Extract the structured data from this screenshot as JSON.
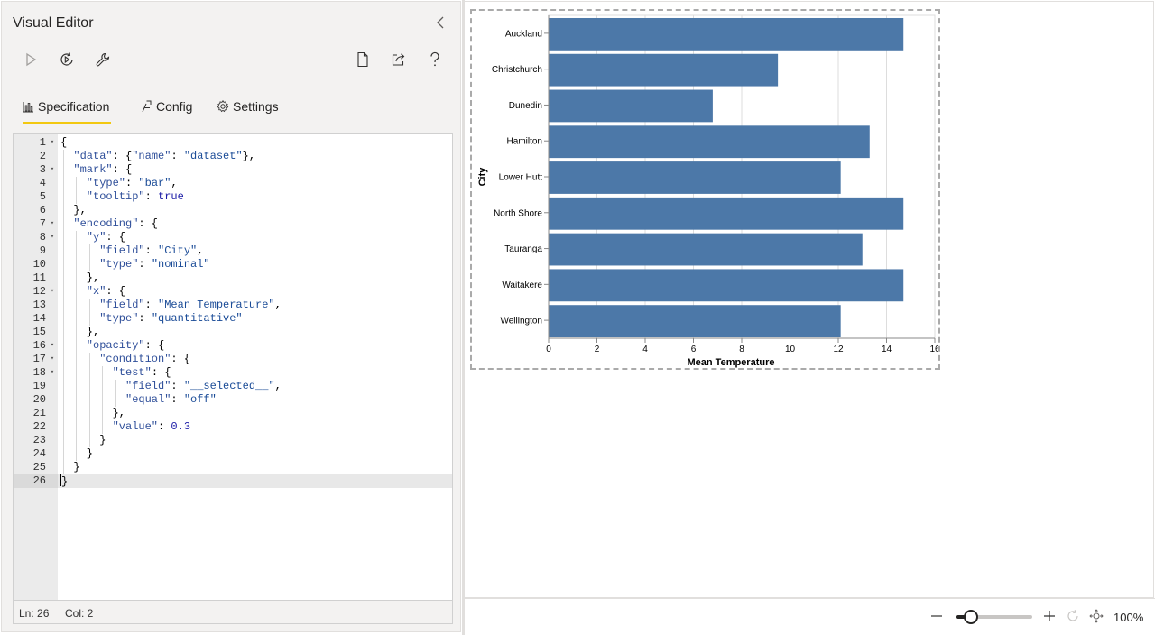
{
  "editor": {
    "title": "Visual Editor",
    "tabs": [
      {
        "label": "Specification",
        "icon": "bar-chart-icon"
      },
      {
        "label": "Config",
        "icon": "config-icon"
      },
      {
        "label": "Settings",
        "icon": "gear-icon"
      }
    ],
    "toolbar_icons": [
      "play-icon",
      "auto-apply-icon",
      "wrench-icon",
      "new-file-icon",
      "share-icon",
      "help-icon"
    ],
    "status": {
      "line": "Ln: 26",
      "col": "Col: 2"
    },
    "current_line": 26,
    "code_lines": [
      {
        "n": "1",
        "fold": true,
        "indent": 0,
        "tokens": [
          [
            "p",
            "{"
          ]
        ]
      },
      {
        "n": "2",
        "fold": false,
        "indent": 1,
        "tokens": [
          [
            "key",
            "\"data\""
          ],
          [
            "p",
            ": {"
          ],
          [
            "key",
            "\"name\""
          ],
          [
            "p",
            ": "
          ],
          [
            "str",
            "\"dataset\""
          ],
          [
            "p",
            "},"
          ]
        ]
      },
      {
        "n": "3",
        "fold": true,
        "indent": 1,
        "tokens": [
          [
            "key",
            "\"mark\""
          ],
          [
            "p",
            ": {"
          ]
        ]
      },
      {
        "n": "4",
        "fold": false,
        "indent": 2,
        "tokens": [
          [
            "key",
            "\"type\""
          ],
          [
            "p",
            ": "
          ],
          [
            "str",
            "\"bar\""
          ],
          [
            "p",
            ","
          ]
        ]
      },
      {
        "n": "5",
        "fold": false,
        "indent": 2,
        "tokens": [
          [
            "key",
            "\"tooltip\""
          ],
          [
            "p",
            ": "
          ],
          [
            "bool",
            "true"
          ]
        ]
      },
      {
        "n": "6",
        "fold": false,
        "indent": 1,
        "tokens": [
          [
            "p",
            "},"
          ]
        ]
      },
      {
        "n": "7",
        "fold": true,
        "indent": 1,
        "tokens": [
          [
            "key",
            "\"encoding\""
          ],
          [
            "p",
            ": {"
          ]
        ]
      },
      {
        "n": "8",
        "fold": true,
        "indent": 2,
        "tokens": [
          [
            "key",
            "\"y\""
          ],
          [
            "p",
            ": {"
          ]
        ]
      },
      {
        "n": "9",
        "fold": false,
        "indent": 3,
        "tokens": [
          [
            "key",
            "\"field\""
          ],
          [
            "p",
            ": "
          ],
          [
            "str",
            "\"City\""
          ],
          [
            "p",
            ","
          ]
        ]
      },
      {
        "n": "10",
        "fold": false,
        "indent": 3,
        "tokens": [
          [
            "key",
            "\"type\""
          ],
          [
            "p",
            ": "
          ],
          [
            "str",
            "\"nominal\""
          ]
        ]
      },
      {
        "n": "11",
        "fold": false,
        "indent": 2,
        "tokens": [
          [
            "p",
            "},"
          ]
        ]
      },
      {
        "n": "12",
        "fold": true,
        "indent": 2,
        "tokens": [
          [
            "key",
            "\"x\""
          ],
          [
            "p",
            ": {"
          ]
        ]
      },
      {
        "n": "13",
        "fold": false,
        "indent": 3,
        "tokens": [
          [
            "key",
            "\"field\""
          ],
          [
            "p",
            ": "
          ],
          [
            "str",
            "\"Mean Temperature\""
          ],
          [
            "p",
            ","
          ]
        ]
      },
      {
        "n": "14",
        "fold": false,
        "indent": 3,
        "tokens": [
          [
            "key",
            "\"type\""
          ],
          [
            "p",
            ": "
          ],
          [
            "str",
            "\"quantitative\""
          ]
        ]
      },
      {
        "n": "15",
        "fold": false,
        "indent": 2,
        "tokens": [
          [
            "p",
            "},"
          ]
        ]
      },
      {
        "n": "16",
        "fold": true,
        "indent": 2,
        "tokens": [
          [
            "key",
            "\"opacity\""
          ],
          [
            "p",
            ": {"
          ]
        ]
      },
      {
        "n": "17",
        "fold": true,
        "indent": 3,
        "tokens": [
          [
            "key",
            "\"condition\""
          ],
          [
            "p",
            ": {"
          ]
        ]
      },
      {
        "n": "18",
        "fold": true,
        "indent": 4,
        "tokens": [
          [
            "key",
            "\"test\""
          ],
          [
            "p",
            ": {"
          ]
        ]
      },
      {
        "n": "19",
        "fold": false,
        "indent": 5,
        "tokens": [
          [
            "key",
            "\"field\""
          ],
          [
            "p",
            ": "
          ],
          [
            "str",
            "\"__selected__\""
          ],
          [
            "p",
            ","
          ]
        ]
      },
      {
        "n": "20",
        "fold": false,
        "indent": 5,
        "tokens": [
          [
            "key",
            "\"equal\""
          ],
          [
            "p",
            ": "
          ],
          [
            "str",
            "\"off\""
          ]
        ]
      },
      {
        "n": "21",
        "fold": false,
        "indent": 4,
        "tokens": [
          [
            "p",
            "},"
          ]
        ]
      },
      {
        "n": "22",
        "fold": false,
        "indent": 4,
        "tokens": [
          [
            "key",
            "\"value\""
          ],
          [
            "p",
            ": "
          ],
          [
            "num",
            "0.3"
          ]
        ]
      },
      {
        "n": "23",
        "fold": false,
        "indent": 3,
        "tokens": [
          [
            "p",
            "}"
          ]
        ]
      },
      {
        "n": "24",
        "fold": false,
        "indent": 2,
        "tokens": [
          [
            "p",
            "}"
          ]
        ]
      },
      {
        "n": "25",
        "fold": false,
        "indent": 1,
        "tokens": [
          [
            "p",
            "}"
          ]
        ]
      },
      {
        "n": "26",
        "fold": false,
        "indent": 0,
        "tokens": [
          [
            "p",
            "}"
          ]
        ]
      }
    ]
  },
  "preview": {
    "zoom_label": "100%",
    "zoom_level": 0.1,
    "bottom_icons": [
      "zoom-out-icon",
      "zoom-in-icon",
      "reset-icon",
      "fit-to-page-icon"
    ]
  },
  "chart_data": {
    "type": "bar",
    "orientation": "horizontal",
    "categories": [
      "Auckland",
      "Christchurch",
      "Dunedin",
      "Hamilton",
      "Lower Hutt",
      "North Shore",
      "Tauranga",
      "Waitakere",
      "Wellington"
    ],
    "values": [
      14.7,
      9.5,
      6.8,
      13.3,
      12.1,
      14.7,
      13.0,
      14.7,
      12.1
    ],
    "xlabel": "Mean Temperature",
    "ylabel": "City",
    "xlim": [
      0,
      16
    ],
    "xticks": [
      "0",
      "2",
      "4",
      "6",
      "8",
      "10",
      "12",
      "14",
      "16"
    ],
    "grid": true,
    "bar_color": "#4c78a8"
  },
  "colors": {
    "accent": "#f2c811",
    "bar": "#4c78a8"
  }
}
